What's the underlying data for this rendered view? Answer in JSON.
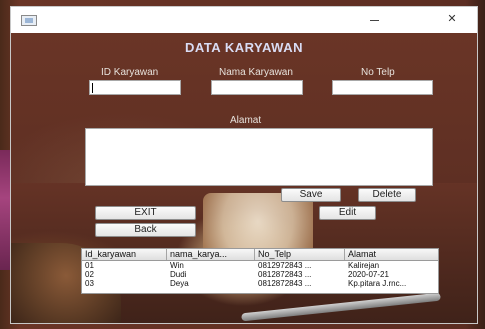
{
  "window": {
    "title": "",
    "minimize_glyph": "—",
    "close_glyph": "✕"
  },
  "form": {
    "heading": "DATA KARYAWAN",
    "id_label": "ID Karyawan",
    "id_value": "",
    "nama_label": "Nama Karyawan",
    "nama_value": "",
    "telp_label": "No Telp",
    "telp_value": "",
    "alamat_label": "Alamat",
    "alamat_value": ""
  },
  "buttons": {
    "save": "Save",
    "delete": "Delete",
    "edit": "Edit",
    "exit": "EXIT",
    "back": "Back"
  },
  "table": {
    "columns": [
      "Id_karyawan",
      "nama_karya...",
      "No_Telp",
      "Alamat"
    ],
    "rows": [
      [
        "01",
        "Win",
        "0812972843 ...",
        "Kalirejan"
      ],
      [
        "02",
        "Dudi",
        "0812872843 ...",
        "2020-07-21"
      ],
      [
        "03",
        "Deya",
        "0812872843 ...",
        "Kp.pitara J.rnc..."
      ]
    ]
  },
  "icons": {
    "app": "window-app-icon",
    "minimize": "minimize-icon",
    "close": "close-icon"
  },
  "colors": {
    "heading": "#d9dcf4",
    "background": "#5e2f23"
  }
}
